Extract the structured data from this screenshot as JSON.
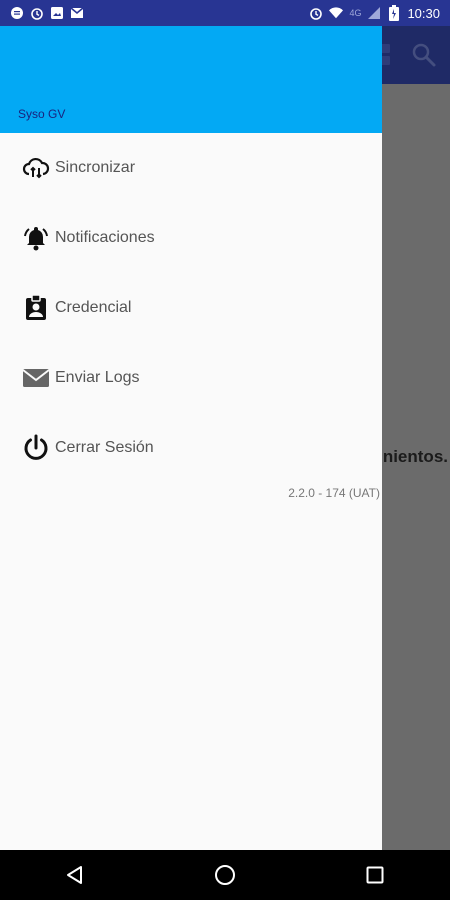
{
  "status_bar": {
    "time": "10:30",
    "network": "4G",
    "icons": [
      "message-icon",
      "alarm-icon",
      "image-icon",
      "gmail-icon",
      "alarm-icon",
      "wifi-icon",
      "signal-icon",
      "battery-icon"
    ]
  },
  "drawer": {
    "user_name": "Syso GV",
    "items": [
      {
        "label": "Sincronizar",
        "icon": "cloud-sync-icon"
      },
      {
        "label": "Notificaciones",
        "icon": "bell-ringing-icon"
      },
      {
        "label": "Credencial",
        "icon": "badge-icon"
      },
      {
        "label": "Enviar Logs",
        "icon": "mail-icon"
      },
      {
        "label": "Cerrar Sesión",
        "icon": "power-icon"
      }
    ],
    "version": "2.2.0 - 174 (UAT)"
  },
  "background": {
    "message": "nientos."
  },
  "colors": {
    "status_bar": "#283593",
    "drawer_header": "#03a9f4",
    "toolbar": "#1f2a66",
    "scrim": "#6b6b6b"
  }
}
